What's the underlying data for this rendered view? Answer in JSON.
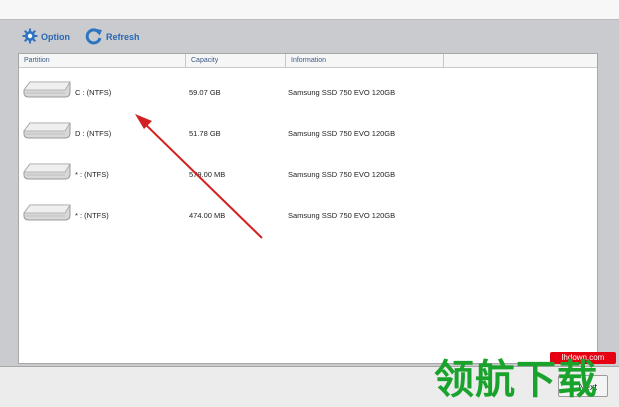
{
  "toolbar": {
    "option_label": "Option",
    "refresh_label": "Refresh"
  },
  "table": {
    "columns": [
      "Partition",
      "Capacity",
      "Information",
      ""
    ],
    "rows": [
      {
        "partition": "C :   (NTFS)",
        "capacity": "59.07 GB",
        "information": "Samsung SSD 750 EVO 120GB"
      },
      {
        "partition": "D :   (NTFS)",
        "capacity": "51.78 GB",
        "information": "Samsung SSD 750 EVO 120GB"
      },
      {
        "partition": "* :   (NTFS)",
        "capacity": "579.00 MB",
        "information": "Samsung SSD 750 EVO 120GB"
      },
      {
        "partition": "* :   (NTFS)",
        "capacity": "474.00 MB",
        "information": "Samsung SSD 750 EVO 120GB"
      }
    ]
  },
  "footer": {
    "next_label": "Next"
  },
  "watermark": {
    "url": "lhdown.com",
    "text": "领航下载"
  },
  "icons": [
    "gear-icon",
    "refresh-icon",
    "hard-disk-icon",
    "red-arrow-annotation"
  ],
  "colors": {
    "toolbar_text": "#2a67b0",
    "arrow": "#d32020",
    "watermark_green": "#1aa32c",
    "watermark_red": "#e60012"
  }
}
